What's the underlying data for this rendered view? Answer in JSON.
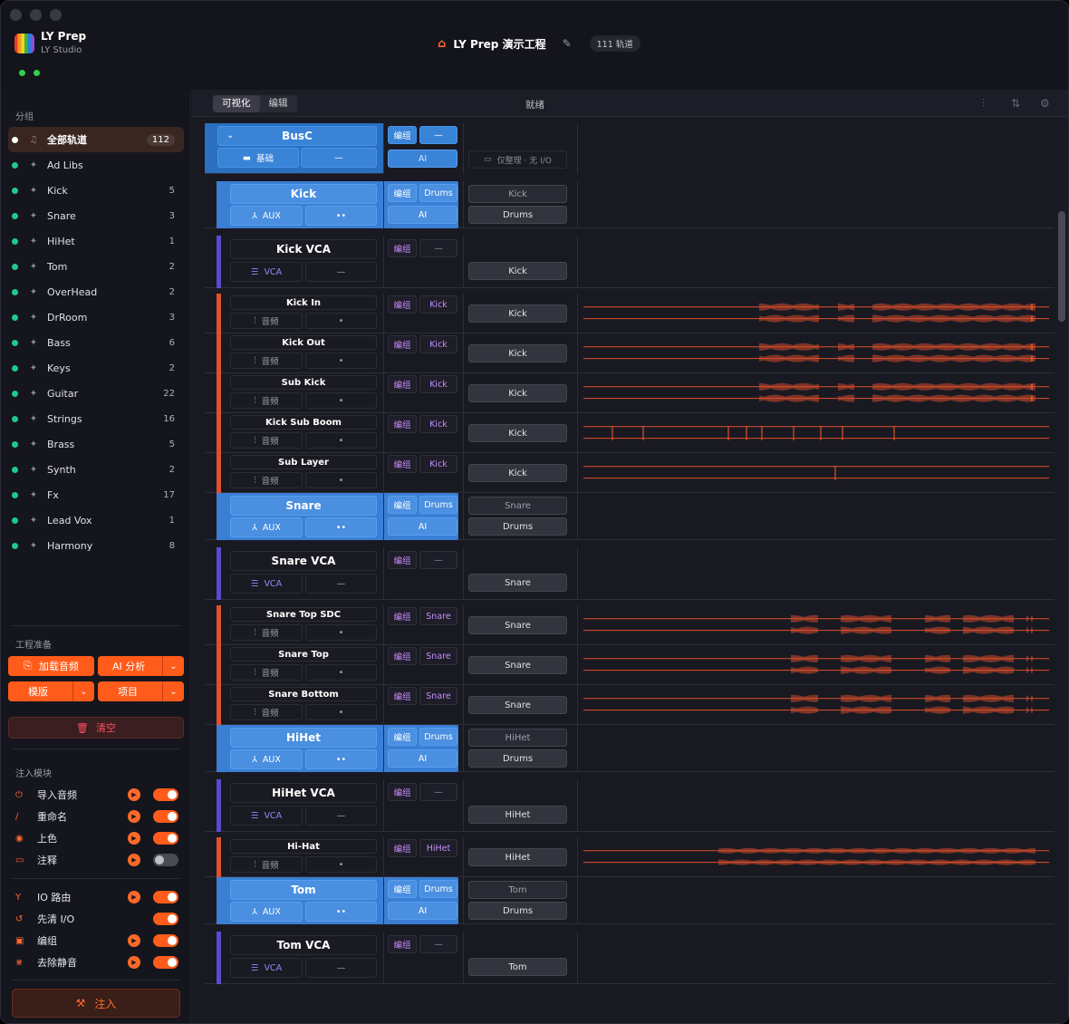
{
  "app": {
    "name": "LY Prep",
    "sub": "LY Studio"
  },
  "header": {
    "title": "LY Prep 演示工程",
    "track_count": "111 轨道"
  },
  "sidebar": {
    "groups_label": "分组",
    "groups": [
      {
        "name": "全部轨道",
        "count": "112",
        "active": true
      },
      {
        "name": "Ad Libs",
        "count": ""
      },
      {
        "name": "Kick",
        "count": "5"
      },
      {
        "name": "Snare",
        "count": "3"
      },
      {
        "name": "HiHet",
        "count": "1"
      },
      {
        "name": "Tom",
        "count": "2"
      },
      {
        "name": "OverHead",
        "count": "2"
      },
      {
        "name": "DrRoom",
        "count": "3"
      },
      {
        "name": "Bass",
        "count": "6"
      },
      {
        "name": "Keys",
        "count": "2"
      },
      {
        "name": "Guitar",
        "count": "22"
      },
      {
        "name": "Strings",
        "count": "16"
      },
      {
        "name": "Brass",
        "count": "5"
      },
      {
        "name": "Synth",
        "count": "2"
      },
      {
        "name": "Fx",
        "count": "17"
      },
      {
        "name": "Lead Vox",
        "count": "1"
      },
      {
        "name": "Harmony",
        "count": "8"
      }
    ],
    "prep_label": "工程准备",
    "load_audio": "加载音频",
    "ai_analyze": "AI 分析",
    "template": "模版",
    "project": "项目",
    "clear": "清空",
    "modules_label": "注入模块",
    "modules": [
      {
        "name": "导入音频",
        "icon": "import-icon",
        "play": true,
        "on": true
      },
      {
        "name": "重命名",
        "icon": "rename-icon",
        "play": true,
        "on": true
      },
      {
        "name": "上色",
        "icon": "palette-icon",
        "play": true,
        "on": true
      },
      {
        "name": "注释",
        "icon": "comment-icon",
        "play": true,
        "on": false
      }
    ],
    "modules2": [
      {
        "name": "IO 路由",
        "icon": "route-icon",
        "play": true,
        "on": true
      },
      {
        "name": "先清 I/O",
        "icon": "reset-icon",
        "play": false,
        "on": true
      },
      {
        "name": "编组",
        "icon": "group-icon",
        "play": true,
        "on": true
      },
      {
        "name": "去除静音",
        "icon": "silence-icon",
        "play": true,
        "on": true
      }
    ],
    "inject": "注入"
  },
  "toolbar": {
    "tab_visual": "可视化",
    "tab_edit": "编辑",
    "status": "就绪"
  },
  "colors": {
    "accent": "#ff5b1a",
    "aux_blue": "#4a8fe0",
    "audio_red": "#e0502a",
    "vca_purple": "#5a4ad0",
    "tag_purple": "#c88cff"
  },
  "tracks": [
    {
      "name": "BusC",
      "type": "bus",
      "sub1": "基础",
      "sub2": "—",
      "tag1": "编组",
      "tag2": "—",
      "tag3": "AI",
      "io": "仅整理 · 无 I/O"
    },
    {
      "name": "Kick",
      "type": "aux",
      "sub1": "AUX",
      "sub2": "••",
      "tag1": "编组",
      "tag2": "Drums",
      "tag3": "AI",
      "io1": "Kick",
      "io2": "Drums"
    },
    {
      "name": "Kick VCA",
      "type": "vca",
      "sub1": "VCA",
      "sub2": "—",
      "tag1": "编组",
      "tag2": "—",
      "io2": "Kick"
    },
    {
      "name": "Kick In",
      "type": "audio",
      "sub1": "音频",
      "sub2": "•",
      "tag1": "编组",
      "tag2": "Kick",
      "io": "Kick",
      "wave": "dense"
    },
    {
      "name": "Kick Out",
      "type": "audio",
      "sub1": "音频",
      "sub2": "•",
      "tag1": "编组",
      "tag2": "Kick",
      "io": "Kick",
      "wave": "dense"
    },
    {
      "name": "Sub Kick",
      "type": "audio",
      "sub1": "音频",
      "sub2": "•",
      "tag1": "编组",
      "tag2": "Kick",
      "io": "Kick",
      "wave": "dense"
    },
    {
      "name": "Kick Sub Boom",
      "type": "audio",
      "sub1": "音频",
      "sub2": "•",
      "tag1": "编组",
      "tag2": "Kick",
      "io": "Kick",
      "wave": "spikes"
    },
    {
      "name": "Sub Layer",
      "type": "audio",
      "sub1": "音频",
      "sub2": "•",
      "tag1": "编组",
      "tag2": "Kick",
      "io": "Kick",
      "wave": "single"
    },
    {
      "name": "Snare",
      "type": "aux",
      "sub1": "AUX",
      "sub2": "••",
      "tag1": "编组",
      "tag2": "Drums",
      "tag3": "AI",
      "io1": "Snare",
      "io2": "Drums"
    },
    {
      "name": "Snare VCA",
      "type": "vca",
      "sub1": "VCA",
      "sub2": "—",
      "tag1": "编组",
      "tag2": "—",
      "io2": "Snare"
    },
    {
      "name": "Snare Top SDC",
      "type": "audio",
      "sub1": "音频",
      "sub2": "•",
      "tag1": "编组",
      "tag2": "Snare",
      "io": "Snare",
      "wave": "snare"
    },
    {
      "name": "Snare Top",
      "type": "audio",
      "sub1": "音频",
      "sub2": "•",
      "tag1": "编组",
      "tag2": "Snare",
      "io": "Snare",
      "wave": "snare"
    },
    {
      "name": "Snare Bottom",
      "type": "audio",
      "sub1": "音频",
      "sub2": "•",
      "tag1": "编组",
      "tag2": "Snare",
      "io": "Snare",
      "wave": "snare"
    },
    {
      "name": "HiHet",
      "type": "aux",
      "sub1": "AUX",
      "sub2": "••",
      "tag1": "编组",
      "tag2": "Drums",
      "tag3": "AI",
      "io1": "HiHet",
      "io2": "Drums"
    },
    {
      "name": "HiHet VCA",
      "type": "vca",
      "sub1": "VCA",
      "sub2": "—",
      "tag1": "编组",
      "tag2": "—",
      "io2": "HiHet"
    },
    {
      "name": "Hi-Hat",
      "type": "audio",
      "sub1": "音频",
      "sub2": "•",
      "tag1": "编组",
      "tag2": "HiHet",
      "io": "HiHet",
      "wave": "hat"
    },
    {
      "name": "Tom",
      "type": "aux",
      "sub1": "AUX",
      "sub2": "••",
      "tag1": "编组",
      "tag2": "Drums",
      "tag3": "AI",
      "io1": "Tom",
      "io2": "Drums"
    },
    {
      "name": "Tom VCA",
      "type": "vca",
      "sub1": "VCA",
      "sub2": "—",
      "tag1": "编组",
      "tag2": "—",
      "io2": "Tom"
    }
  ]
}
